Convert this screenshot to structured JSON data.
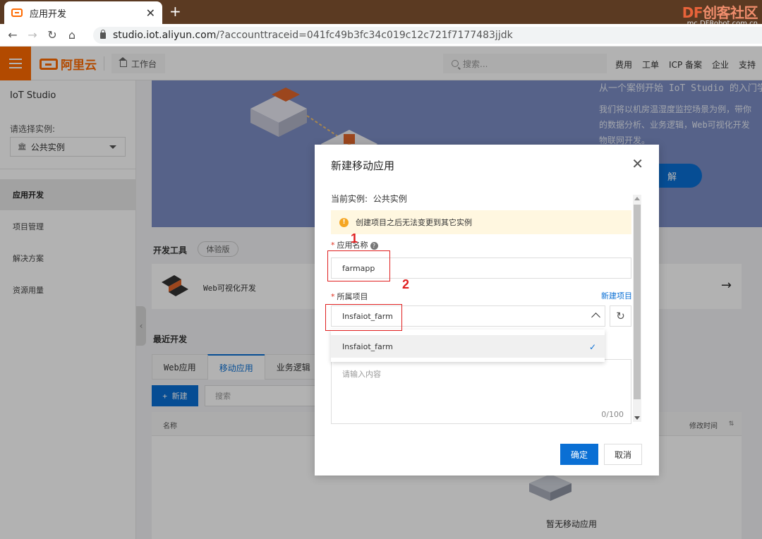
{
  "browser": {
    "tab_title": "应用开发",
    "new_tab": "+",
    "url_host": "studio.iot.aliyun.com",
    "url_rest": "/?accounttraceid=041fc49b3fc34c019c12c721f7177483jjdk",
    "watermark_brand": "DF",
    "watermark_cn": "创客社区",
    "watermark_site": "mc.DFRobot.com.cn"
  },
  "topnav": {
    "logo_text": "阿里云",
    "workbench": "工作台",
    "search_placeholder": "搜索...",
    "links": [
      "费用",
      "工单",
      "ICP 备案",
      "企业",
      "支持"
    ]
  },
  "sidebar": {
    "title": "IoT Studio",
    "instance_label": "请选择实例:",
    "instance_value": "公共实例",
    "items": [
      "应用开发",
      "项目管理",
      "解决方案",
      "资源用量"
    ],
    "active_index": 0
  },
  "banner": {
    "line1": "从一个案例开始 IoT Studio 的入门学",
    "line2": "我们将以机房温湿度监控场景为例，带你",
    "line3": "的数据分析、业务逻辑，Web可视化开发",
    "line4": "物联网开发。",
    "button_suffix": "解"
  },
  "dev_tools": {
    "title": "开发工具",
    "badge": "体验版",
    "tool_name": "Web可视化开发",
    "arrow": "→"
  },
  "recent": {
    "title": "最近开发",
    "tabs": [
      "Web应用",
      "移动应用",
      "业务逻辑"
    ],
    "active_tab": 1,
    "new_button": "+ 新建",
    "search_placeholder": "搜索",
    "col_name": "名称",
    "col_time": "修改时间",
    "empty_text": "暂无移动应用"
  },
  "modal": {
    "title": "新建移动应用",
    "current_instance_label": "当前实例:",
    "current_instance_value": "公共实例",
    "alert_text": "创建项目之后无法变更到其它实例",
    "app_name_label": "应用名称",
    "app_name_value": "farmapp",
    "project_label": "所属项目",
    "new_project_link": "新建项目",
    "project_value": "Insfaiot_farm",
    "dropdown_options": [
      "Insfaiot_farm"
    ],
    "description_placeholder": "请输入内容",
    "description_counter": "0/100",
    "ok_button": "确定",
    "cancel_button": "取消"
  },
  "annotations": {
    "num1": "1",
    "num2": "2"
  },
  "colors": {
    "aliyun_orange": "#ff6a00",
    "primary_blue": "#0a6fd4",
    "annotation_red": "#e02020",
    "alert_bg": "#fff7e0"
  }
}
